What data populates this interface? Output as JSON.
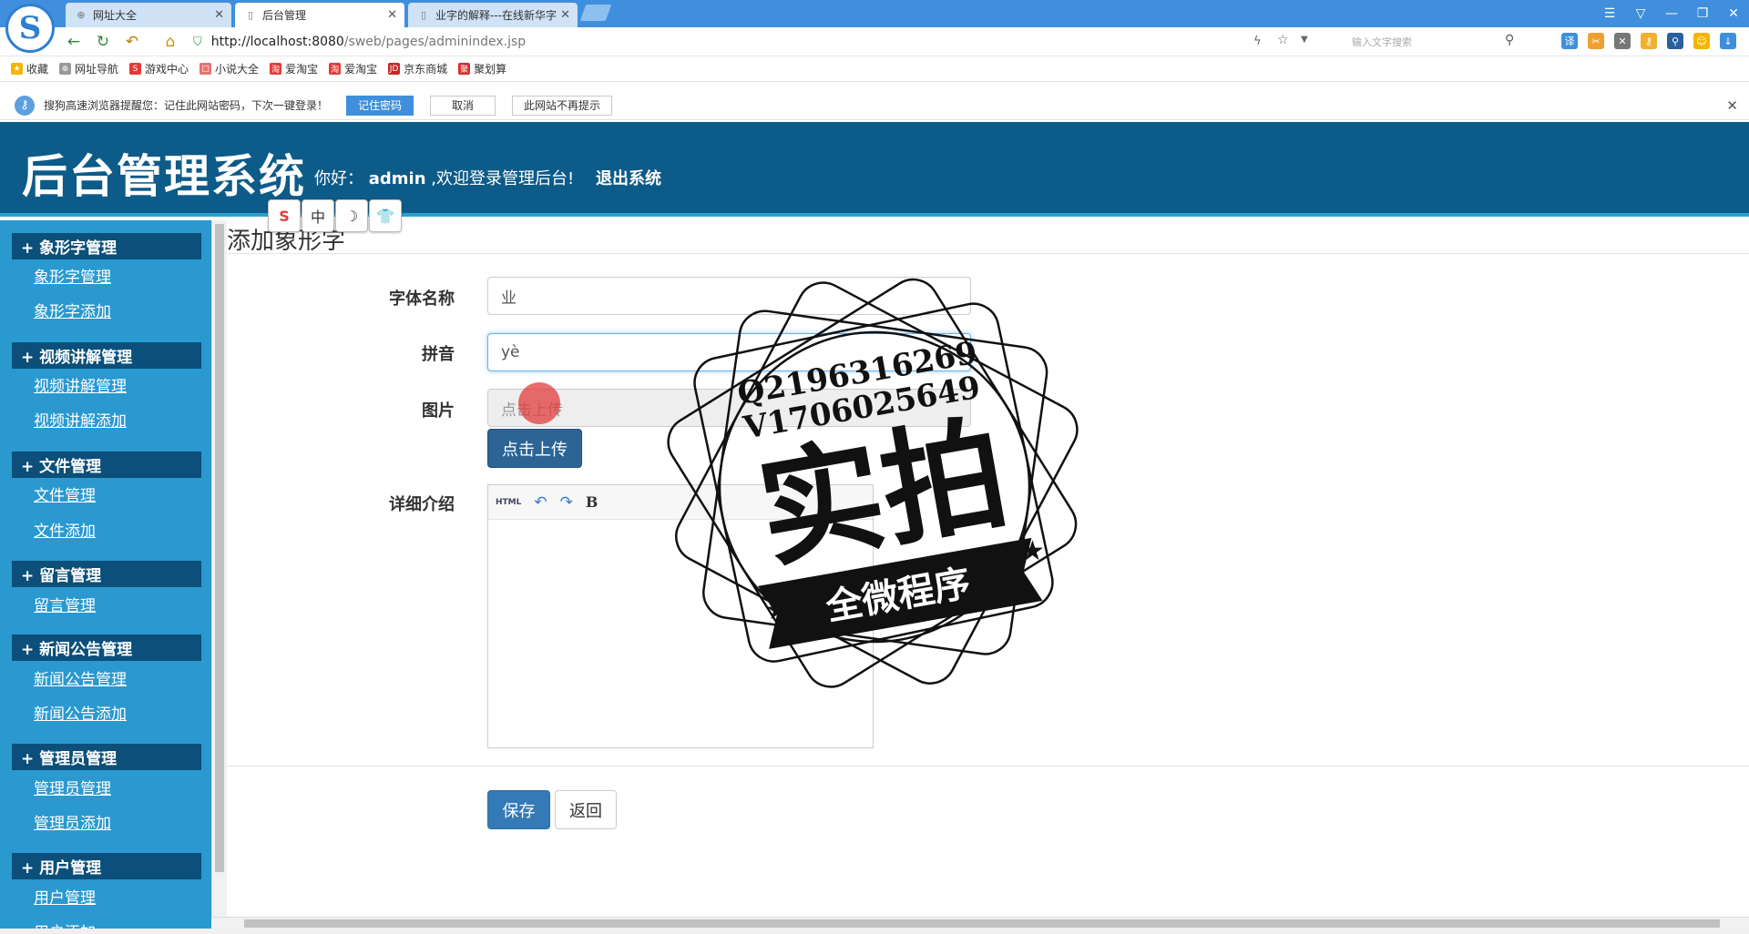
{
  "browser": {
    "tabs": [
      {
        "label": "网址大全",
        "icon": "globe-icon",
        "active": false
      },
      {
        "label": "后台管理",
        "icon": "page-icon",
        "active": true
      },
      {
        "label": "业字的解释---在线新华字",
        "icon": "page-icon",
        "active": false
      }
    ],
    "address": {
      "host": "http://localhost:8080",
      "path": "/sweb/pages/adminindex.jsp"
    },
    "search_placeholder": "输入文字搜索",
    "bookmarks": [
      {
        "label": "收藏",
        "icon": "star-icon",
        "color": "#f5b400"
      },
      {
        "label": "网址导航",
        "icon": "globe-icon",
        "color": "#888888"
      },
      {
        "label": "游戏中心",
        "icon": "game-icon",
        "color": "#e53935"
      },
      {
        "label": "小说大全",
        "icon": "book-icon",
        "color": "#e57373"
      },
      {
        "label": "爱淘宝",
        "icon": "taobao-icon",
        "color": "#e53935"
      },
      {
        "label": "爱淘宝",
        "icon": "taobao-icon",
        "color": "#e53935"
      },
      {
        "label": "京东商城",
        "icon": "jd-icon",
        "color": "#c62828"
      },
      {
        "label": "聚划算",
        "icon": "juhuasuan-icon",
        "color": "#d32f2f"
      }
    ],
    "infobar": {
      "text": "搜狗高速浏览器提醒您：记住此网站密码，下次一键登录！",
      "remember": "记住密码",
      "cancel": "取消",
      "never": "此网站不再提示"
    }
  },
  "app": {
    "title": "后台管理系统",
    "greet_prefix": "你好：",
    "username": "admin",
    "greet_suffix": ",欢迎登录管理后台!",
    "logout": "退出系统"
  },
  "sidebar": {
    "sections": [
      {
        "head": "+ 象形字管理",
        "links": [
          "象形字管理",
          "象形字添加"
        ]
      },
      {
        "head": "+ 视频讲解管理",
        "links": [
          "视频讲解管理",
          "视频讲解添加"
        ]
      },
      {
        "head": "+ 文件管理",
        "links": [
          "文件管理",
          "文件添加"
        ]
      },
      {
        "head": "+ 留言管理",
        "links": [
          "留言管理"
        ]
      },
      {
        "head": "+ 新闻公告管理",
        "links": [
          "新闻公告管理",
          "新闻公告添加"
        ]
      },
      {
        "head": "+ 管理员管理",
        "links": [
          "管理员管理",
          "管理员添加"
        ]
      },
      {
        "head": "+ 用户管理",
        "links": [
          "用户管理",
          "用户添加"
        ]
      }
    ]
  },
  "form": {
    "page_title": "添加象形字",
    "name_label": "字体名称",
    "name_value": "业",
    "pinyin_label": "拼音",
    "pinyin_value": "yè",
    "image_label": "图片",
    "image_placeholder": "点击上传",
    "upload_button": "点击上传",
    "detail_label": "详细介绍",
    "editor_toolbar": [
      "HTML",
      "↶",
      "↷",
      "B"
    ],
    "save": "保存",
    "back": "返回"
  },
  "watermark": {
    "qq": "Q2196316269",
    "wx": "V1706025649",
    "big": "实拍",
    "banner": "全微程序"
  },
  "colors": {
    "header": "#0d5b88",
    "sidebar": "#2a99d0",
    "section_head": "#0b4f7a",
    "browser_accent": "#3f8fdd",
    "primary_button": "#337ab7"
  }
}
